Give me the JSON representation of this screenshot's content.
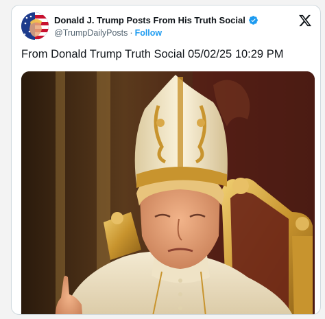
{
  "post": {
    "display_name": "Donald J. Trump Posts From His Truth Social",
    "handle": "@TrumpDailyPosts",
    "separator": "·",
    "follow_label": "Follow",
    "text": "From Donald Trump Truth Social 05/02/25 10:29 PM"
  },
  "icons": {
    "verified": "verified-badge-icon",
    "platform": "x-logo-icon"
  },
  "colors": {
    "accent": "#1d9bf0",
    "text": "#0f1419",
    "muted": "#536471",
    "border": "#cfd9de"
  }
}
